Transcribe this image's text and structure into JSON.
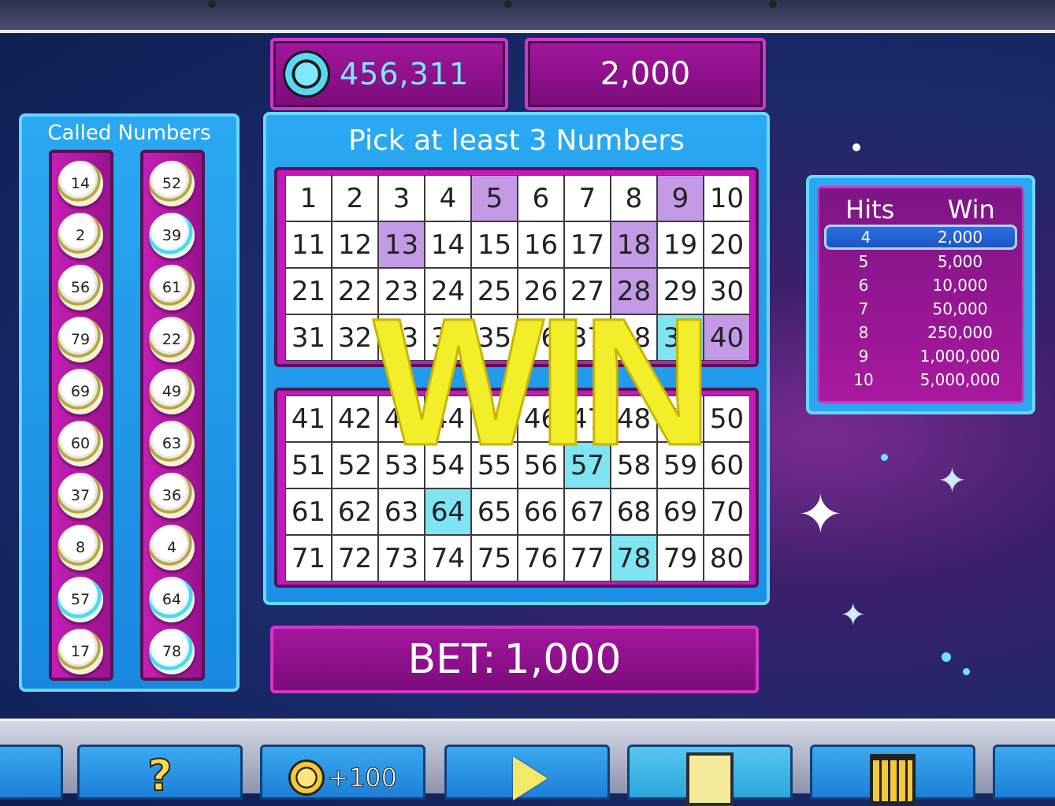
{
  "header": {
    "balance": "456,311",
    "last_win": "2,000"
  },
  "called_numbers": {
    "title": "Called Numbers",
    "column_1": [
      {
        "n": "14",
        "hit": false
      },
      {
        "n": "2",
        "hit": false
      },
      {
        "n": "56",
        "hit": false
      },
      {
        "n": "79",
        "hit": false
      },
      {
        "n": "69",
        "hit": false
      },
      {
        "n": "60",
        "hit": false
      },
      {
        "n": "37",
        "hit": false
      },
      {
        "n": "8",
        "hit": false
      },
      {
        "n": "57",
        "hit": true
      },
      {
        "n": "17",
        "hit": false
      }
    ],
    "column_2": [
      {
        "n": "52",
        "hit": false
      },
      {
        "n": "39",
        "hit": true
      },
      {
        "n": "61",
        "hit": false
      },
      {
        "n": "22",
        "hit": false
      },
      {
        "n": "49",
        "hit": false
      },
      {
        "n": "63",
        "hit": false
      },
      {
        "n": "36",
        "hit": false
      },
      {
        "n": "4",
        "hit": false
      },
      {
        "n": "64",
        "hit": true
      },
      {
        "n": "78",
        "hit": true
      }
    ]
  },
  "board": {
    "title": "Pick at least 3 Numbers",
    "picked": [
      5,
      9,
      13,
      18,
      28,
      40
    ],
    "hits": [
      39,
      57,
      64,
      78
    ],
    "colors": {
      "picked": "#c49ae6",
      "hit": "#7fe5f2"
    }
  },
  "win_banner": "WIN",
  "bet": {
    "label": "BET:",
    "value": "1,000"
  },
  "paytable": {
    "header_hits": "Hits",
    "header_win": "Win",
    "rows": [
      {
        "hits": "4",
        "win": "2,000",
        "active": true
      },
      {
        "hits": "5",
        "win": "5,000",
        "active": false
      },
      {
        "hits": "6",
        "win": "10,000",
        "active": false
      },
      {
        "hits": "7",
        "win": "50,000",
        "active": false
      },
      {
        "hits": "8",
        "win": "250,000",
        "active": false
      },
      {
        "hits": "9",
        "win": "1,000,000",
        "active": false
      },
      {
        "hits": "10",
        "win": "5,000,000",
        "active": false
      }
    ]
  },
  "toolbar": {
    "help_icon": "question-mark-icon",
    "add_coins_label": "+100",
    "play_icon": "play-icon",
    "quick_pick_icon": "card-icon",
    "clear_icon": "trash-icon"
  }
}
